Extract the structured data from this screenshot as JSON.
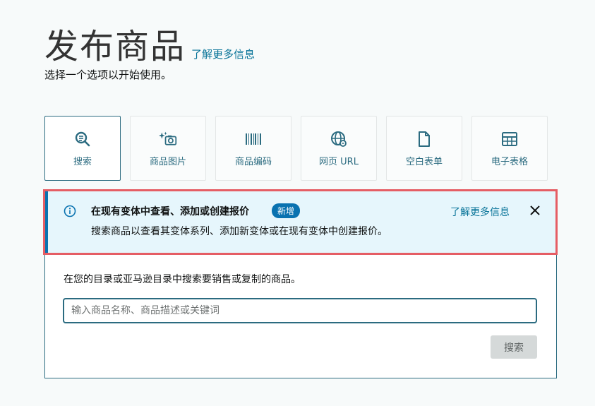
{
  "header": {
    "title": "发布商品",
    "learn_more": "了解更多信息",
    "subtitle": "选择一个选项以开始使用。"
  },
  "options": [
    {
      "label": "搜索",
      "icon": "search-icon",
      "selected": true
    },
    {
      "label": "商品图片",
      "icon": "sparkle-camera-icon",
      "selected": false
    },
    {
      "label": "商品编码",
      "icon": "barcode-icon",
      "selected": false
    },
    {
      "label": "网页 URL",
      "icon": "globe-link-icon",
      "selected": false
    },
    {
      "label": "空白表单",
      "icon": "document-icon",
      "selected": false
    },
    {
      "label": "电子表格",
      "icon": "spreadsheet-icon",
      "selected": false
    }
  ],
  "alert": {
    "title": "在现有变体中查看、添加或创建报价",
    "badge": "新增",
    "learn_more": "了解更多信息",
    "description": "搜索商品以查看其变体系列、添加新变体或在现有变体中创建报价。"
  },
  "search": {
    "description": "在您的目录或亚马逊目录中搜索要销售或复制的商品。",
    "placeholder": "输入商品名称、商品描述或关键词",
    "value": "",
    "button_label": "搜索"
  },
  "colors": {
    "accent": "#2b6b80",
    "link": "#077398",
    "alert_bg": "#e6f6fc",
    "alert_border": "#0972b0",
    "highlight": "#e55d64"
  }
}
